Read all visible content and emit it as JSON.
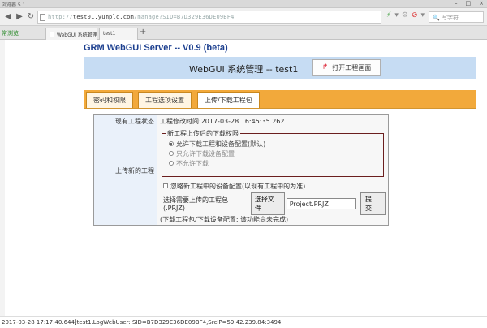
{
  "browser": {
    "title": "浏览器 5.1",
    "url_prefix": "http://",
    "url_host": "test01.yumplc.com",
    "url_path": "/manage?SID=B7D329E36DE09BF4",
    "search_placeholder": "写字符",
    "favorites_label": "常浏览",
    "tabs": [
      {
        "label": "WebGUI 系统管理"
      },
      {
        "label": "test1"
      }
    ]
  },
  "app": {
    "title": "GRM WebGUI Server -- V0.9 (beta)",
    "banner_text": "WebGUI 系统管理 -- test1",
    "open_project_label": "打开工程画面"
  },
  "page_tabs": [
    {
      "label": "密码和权限",
      "active": false
    },
    {
      "label": "工程选项设置",
      "active": false
    },
    {
      "label": "上传/下载工程包",
      "active": true
    }
  ],
  "form": {
    "status_label": "现有工程状态",
    "status_value": "工程修改时间:2017-03-28 16:45:35.262",
    "upload_label": "上传新的工程",
    "fieldset_legend": "新工程上传后的下载权限",
    "radio_options": [
      {
        "label": "允许下载工程和设备配置(默认)",
        "checked": true,
        "dim": false
      },
      {
        "label": "只允许下载设备配置",
        "checked": false,
        "dim": true
      },
      {
        "label": "不允许下载",
        "checked": false,
        "dim": true
      }
    ],
    "ignore_config_label": "忽略新工程中的设备配置(以现有工程中的为准)",
    "choose_file_prompt": "选择需要上传的工程包(.PRJZ)",
    "choose_file_button": "选择文件",
    "file_name": "Project.PRJZ",
    "submit_label": "提交!",
    "download_note": "(下载工程包/下载设备配置: 该功能尚未完成)"
  },
  "status_bar": {
    "text": "2017-03-28 17:17:40.644]test1.LogWebUser: SID=B7D329E36DE09BF4,SrcIP=59.42.239.84:3494"
  }
}
